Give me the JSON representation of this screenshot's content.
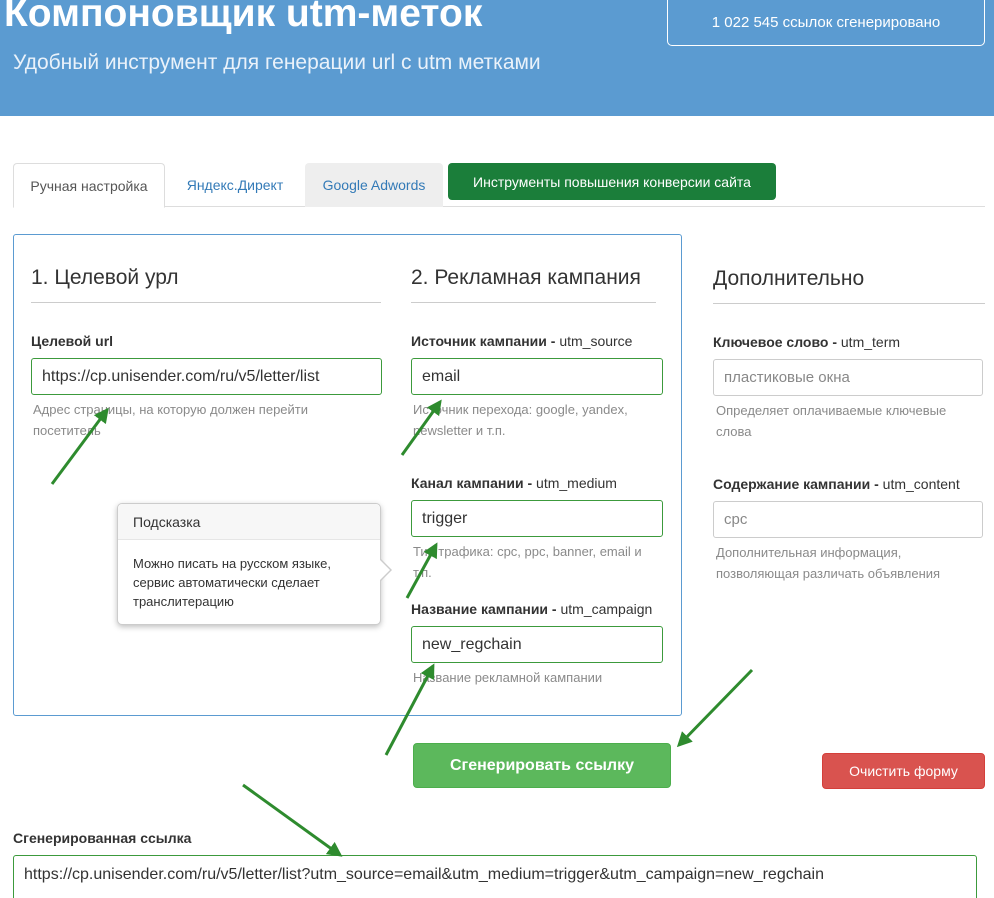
{
  "header": {
    "title": "Компоновщик utm-меток",
    "subtitle": "Удобный инструмент для генерации url с utm метками",
    "counter": "1 022 545 ссылок сгенерировано"
  },
  "tabs": [
    {
      "label": "Ручная настройка",
      "active": true
    },
    {
      "label": "Яндекс.Директ",
      "active": false
    },
    {
      "label": "Google Adwords",
      "active": false
    },
    {
      "label": "Инструменты повышения конверсии сайта",
      "active": false
    }
  ],
  "sections": {
    "target": {
      "title": "1. Целевой урл",
      "field_label": "Целевой url",
      "value": "https://cp.unisender.com/ru/v5/letter/list",
      "help": "Адрес страницы, на которую должен перейти посетитель"
    },
    "campaign": {
      "title": "2. Рекламная кампания",
      "source": {
        "label": "Источник кампании -",
        "param": "utm_source",
        "value": "email",
        "help": "Источник перехода: google, yandex, newsletter и т.п."
      },
      "medium": {
        "label": "Канал кампании -",
        "param": "utm_medium",
        "value": "trigger",
        "help": "Тип трафика: cpc, ppc, banner, email и т.п."
      },
      "name": {
        "label": "Название кампании -",
        "param": "utm_campaign",
        "value": "new_regchain",
        "help": "Название рекламной кампании"
      }
    },
    "extra": {
      "title": "Дополнительно",
      "term": {
        "label": "Ключевое слово -",
        "param": "utm_term",
        "placeholder": "пластиковые окна",
        "help": "Определяет оплачиваемые ключевые слова"
      },
      "content": {
        "label": "Содержание кампании -",
        "param": "utm_content",
        "placeholder": "cpc",
        "help": "Дополнительная информация, позволяющая различать объявления"
      }
    }
  },
  "tooltip": {
    "title": "Подсказка",
    "body": "Можно писать на русском языке, сервис автоматически сделает транслитерацию"
  },
  "buttons": {
    "generate": "Сгенерировать ссылку",
    "clear": "Очистить форму"
  },
  "result": {
    "label": "Сгенерированная ссылка",
    "value": "https://cp.unisender.com/ru/v5/letter/list?utm_source=email&utm_medium=trigger&utm_campaign=new_regchain"
  },
  "colors": {
    "header_bg": "#5b9bd1",
    "arrow": "#2e8b2e",
    "generate_button": "#5cb85c",
    "clear_button": "#d9534f",
    "tools_tab": "#1b7e3a"
  }
}
